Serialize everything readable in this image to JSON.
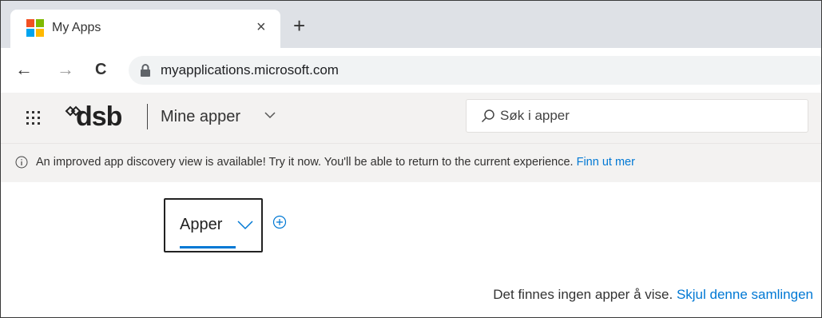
{
  "browser": {
    "tab_title": "My Apps",
    "tab_close": "×",
    "new_tab": "+",
    "back": "←",
    "forward": "→",
    "reload": "C",
    "url": "myapplications.microsoft.com"
  },
  "header": {
    "logo_text": "dsb",
    "app_title": "Mine apper",
    "search_placeholder": "Søk i apper"
  },
  "banner": {
    "text": "An improved app discovery view is available! Try it now. You'll be able to return to the current experience.",
    "link": "Finn ut mer"
  },
  "content": {
    "collection_label": "Apper",
    "empty_text": "Det finnes ingen apper å vise.",
    "empty_link": "Skjul denne samlingen"
  },
  "colors": {
    "accent": "#0078d4",
    "ms_red": "#f25022",
    "ms_green": "#7fba00",
    "ms_blue": "#00a4ef",
    "ms_yellow": "#ffb900"
  }
}
